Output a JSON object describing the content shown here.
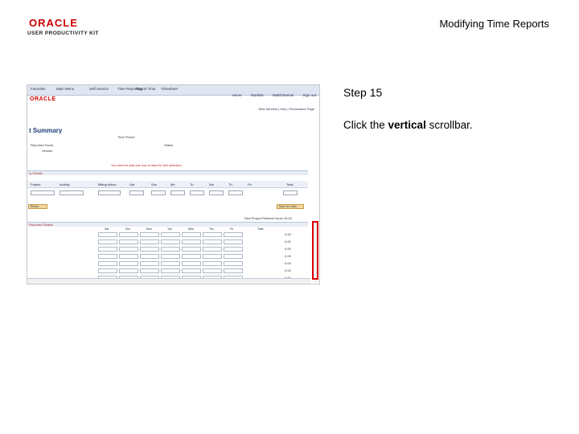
{
  "header": {
    "logo_word": "ORACLE",
    "logo_sub": "USER PRODUCTIVITY KIT",
    "title": "Modifying Time Reports"
  },
  "step": {
    "label": "Step 15",
    "instruction_pre": "Click the ",
    "instruction_bold": "vertical",
    "instruction_post": " scrollbar."
  },
  "screenshot": {
    "tabs": [
      "Favorites",
      "Main Menu",
      "Self Service",
      "Time Reporting",
      "Report Time",
      "Timesheet"
    ],
    "oracle_mini": "ORACLE",
    "nav_links": [
      "Home",
      "Worklist",
      "MultiChannel",
      "Sign out"
    ],
    "subnav": "New Window | Help | Personalize Page",
    "summary_title": "t Summary",
    "meta": [
      "Time Period",
      "Status",
      "Reported Hours",
      "Version"
    ],
    "warn": "You need to add one row of data for this selection",
    "section_1": "ry Details",
    "grid_headers": [
      "Project",
      "Activity",
      "Billing Action",
      "Sat",
      "Sun",
      "Mo",
      "Tu",
      "We",
      "Th",
      "Fri",
      "Total"
    ],
    "button_left": "Return",
    "button_right": "Save for Later",
    "totals": "Total Project  Related Hours   33.00",
    "section_2": "Reported Details",
    "rep_headers": [
      "Sat",
      "Sun",
      "Mon",
      "Tue",
      "Wed",
      "Thu",
      "Fri",
      "Total"
    ],
    "rep_values": [
      "0.00",
      "0.00",
      "0.00",
      "0.00",
      "0.00",
      "0.00",
      "0.00"
    ]
  }
}
